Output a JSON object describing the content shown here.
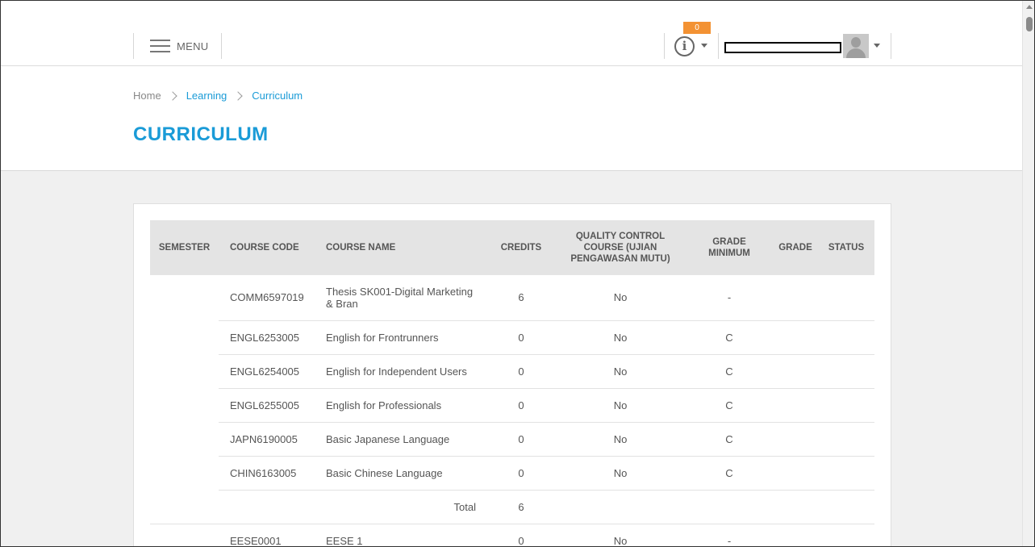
{
  "header": {
    "menu_label": "MENU",
    "notification_count": "0"
  },
  "breadcrumb": {
    "items": [
      "Home",
      "Learning",
      "Curriculum"
    ]
  },
  "page_title": "CURRICULUM",
  "table": {
    "headers": {
      "semester": "SEMESTER",
      "course_code": "COURSE CODE",
      "course_name": "COURSE NAME",
      "credits": "CREDITS",
      "quality_control": "QUALITY CONTROL COURSE (UJIAN PENGAWASAN MUTU)",
      "grade_minimum": "GRADE MINIMUM",
      "grade": "GRADE",
      "status": "STATUS"
    },
    "rows": [
      {
        "semester": "",
        "code": "COMM6597019",
        "name": "Thesis SK001-Digital Marketing & Bran",
        "credits": "6",
        "qc": "No",
        "grade_min": "-",
        "grade": "",
        "status": ""
      },
      {
        "semester": "",
        "code": "ENGL6253005",
        "name": "English for Frontrunners",
        "credits": "0",
        "qc": "No",
        "grade_min": "C",
        "grade": "",
        "status": ""
      },
      {
        "semester": "",
        "code": "ENGL6254005",
        "name": "English for Independent Users",
        "credits": "0",
        "qc": "No",
        "grade_min": "C",
        "grade": "",
        "status": ""
      },
      {
        "semester": "",
        "code": "ENGL6255005",
        "name": "English for Professionals",
        "credits": "0",
        "qc": "No",
        "grade_min": "C",
        "grade": "",
        "status": ""
      },
      {
        "semester": "",
        "code": "JAPN6190005",
        "name": "Basic Japanese Language",
        "credits": "0",
        "qc": "No",
        "grade_min": "C",
        "grade": "",
        "status": ""
      },
      {
        "semester": "",
        "code": "CHIN6163005",
        "name": "Basic Chinese Language",
        "credits": "0",
        "qc": "No",
        "grade_min": "C",
        "grade": "",
        "status": ""
      }
    ],
    "total": {
      "label": "Total",
      "credits": "6"
    },
    "rows_after": [
      {
        "semester": "",
        "code": "EESE0001",
        "name": "EESE 1",
        "credits": "0",
        "qc": "No",
        "grade_min": "-",
        "grade": "",
        "status": ""
      }
    ]
  },
  "colors": {
    "accent": "#1a9bd7",
    "badge": "#f39233",
    "header_bg": "#e4e4e4",
    "page_bg": "#f0f0f0"
  }
}
